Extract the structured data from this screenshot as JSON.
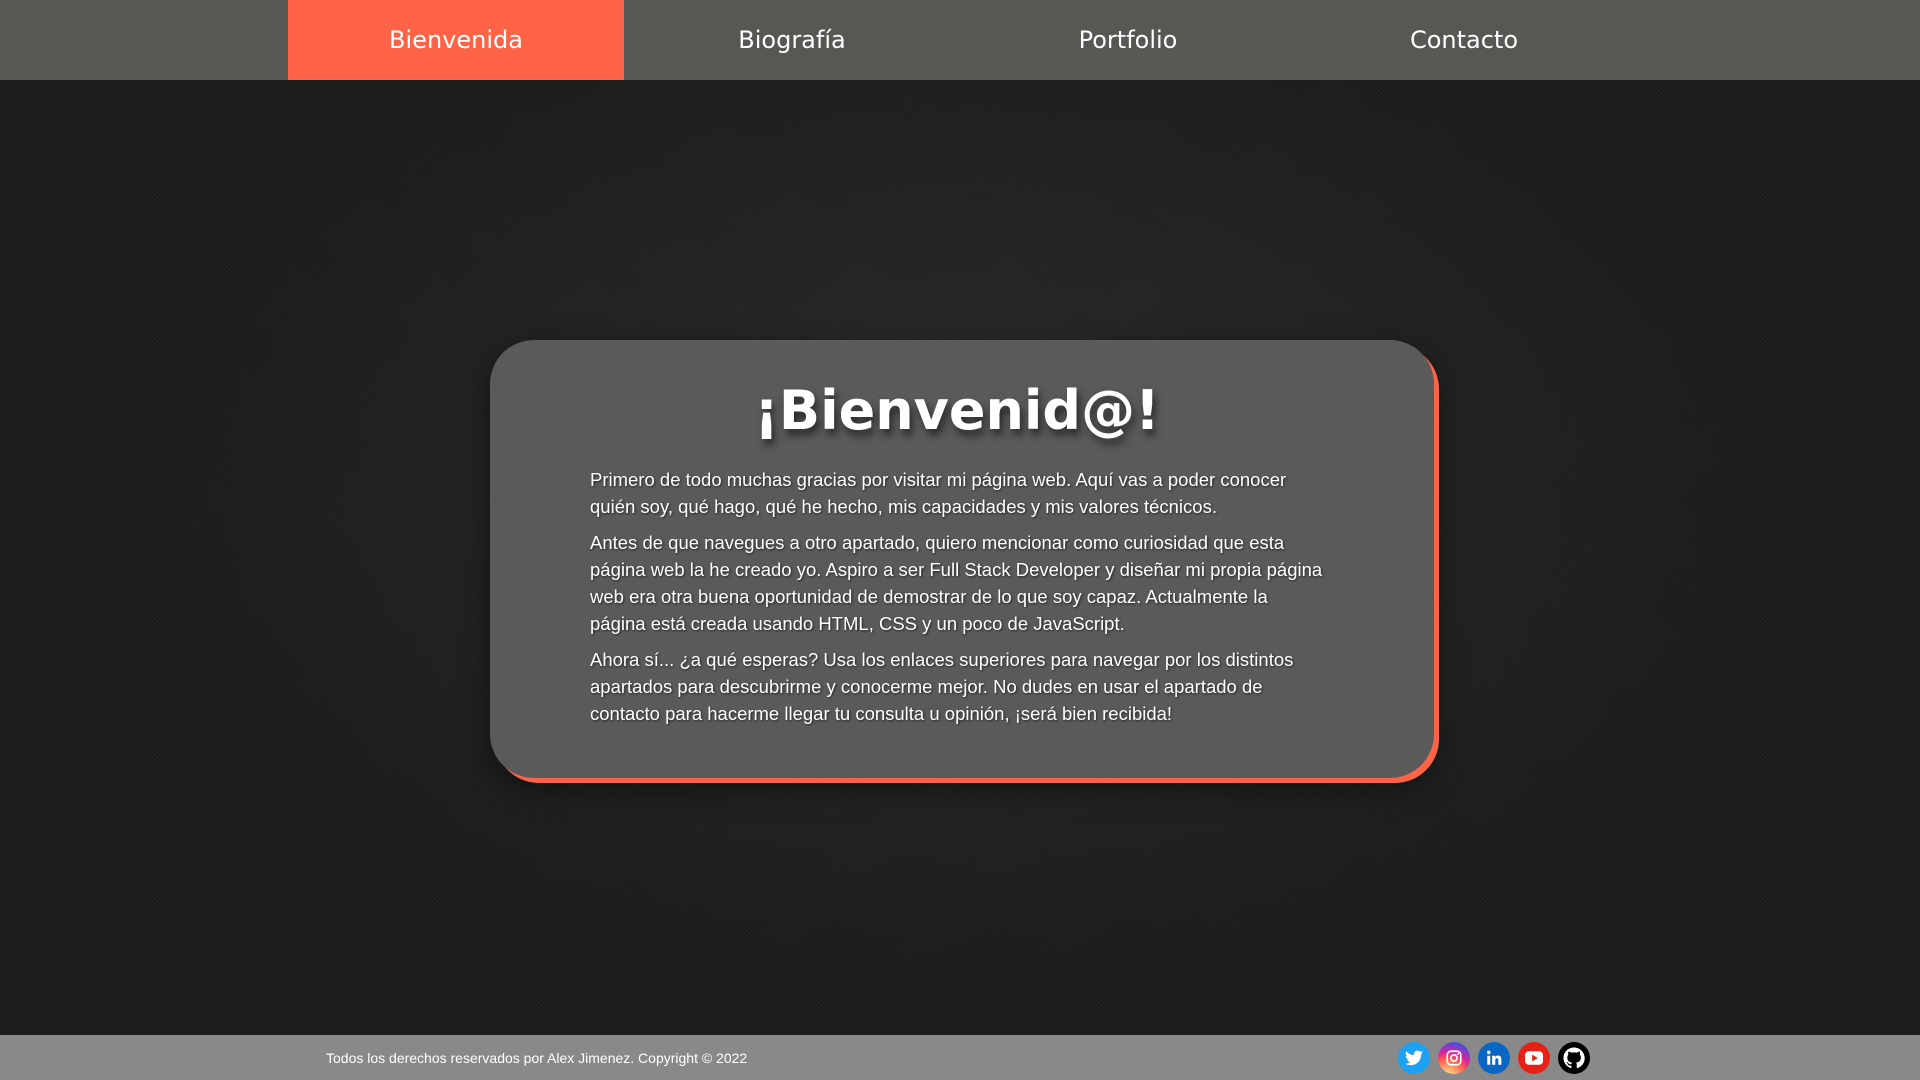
{
  "nav": {
    "items": [
      {
        "label": "Bienvenida",
        "active": true
      },
      {
        "label": "Biografía",
        "active": false
      },
      {
        "label": "Portfolio",
        "active": false
      },
      {
        "label": "Contacto",
        "active": false
      }
    ],
    "bg_color": "#575754",
    "accent_color": "#ff6347"
  },
  "main": {
    "title": "¡Bienvenid@!",
    "paragraphs": [
      "Primero de todo muchas gracias por visitar mi página web. Aquí vas a poder conocer quién soy, qué hago, qué he hecho, mis capacidades y mis valores técnicos.",
      "Antes de que navegues a otro apartado, quiero mencionar como curiosidad que esta página web la he creado yo. Aspiro a ser Full Stack Developer y diseñar mi propia página web era otra buena oportunidad de demostrar de lo que soy capaz. Actualmente la página está creada usando HTML, CSS y un poco de JavaScript.",
      "Ahora sí... ¿a qué esperas? Usa los enlaces superiores para navegar por los distintos apartados para descubrirme y conocerme mejor. No dudes en usar el apartado de contacto para hacerme llegar tu consulta u opinión, ¡será bien recibida!"
    ],
    "card_color": "#5a5a5a"
  },
  "footer": {
    "copyright": "Todos los derechos reservados por Alex Jimenez. Copyright © 2022",
    "bg_color": "#898989",
    "socials": [
      {
        "icon": "twitter-icon",
        "color": "#1da1f2"
      },
      {
        "icon": "instagram-icon",
        "color": "#c13584"
      },
      {
        "icon": "linkedin-icon",
        "color": "#0a66c2"
      },
      {
        "icon": "youtube-icon",
        "color": "#e62117"
      },
      {
        "icon": "github-icon",
        "color": "#000000"
      }
    ]
  }
}
